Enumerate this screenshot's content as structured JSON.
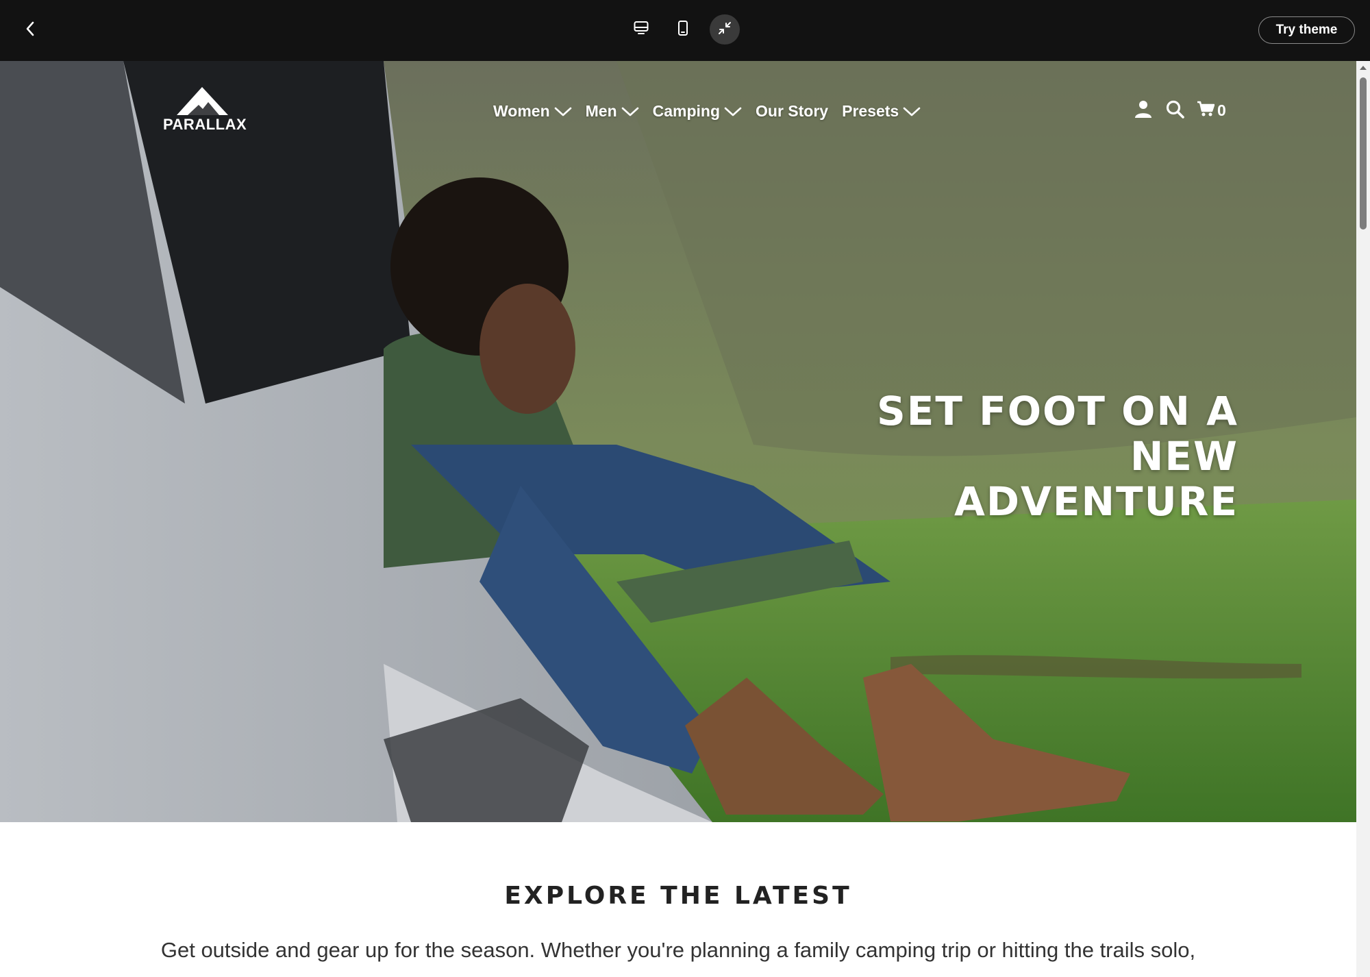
{
  "toolbar": {
    "back_icon": "chevron-left-icon",
    "view_buttons": [
      {
        "icon": "desktop-icon",
        "active": false
      },
      {
        "icon": "mobile-icon",
        "active": false
      },
      {
        "icon": "collapse-icon",
        "active": true
      }
    ],
    "try_theme_label": "Try theme"
  },
  "header": {
    "logo_text": "PARALLAX",
    "nav": [
      {
        "label": "Women",
        "has_dropdown": true
      },
      {
        "label": "Men",
        "has_dropdown": true
      },
      {
        "label": "Camping",
        "has_dropdown": true
      },
      {
        "label": "Our Story",
        "has_dropdown": false
      },
      {
        "label": "Presets",
        "has_dropdown": true
      }
    ],
    "icons": [
      "user-icon",
      "search-icon",
      "cart-icon"
    ],
    "cart_count": "0"
  },
  "hero": {
    "title_line1": "SET FOOT ON A NEW",
    "title_line2": "ADVENTURE"
  },
  "explore": {
    "title": "EXPLORE THE LATEST",
    "text": "Get outside and gear up for the season. Whether you're planning a family camping trip or hitting the trails solo,"
  },
  "colors": {
    "topbar": "#121212",
    "text_dark": "#222222",
    "hero_text": "#ffffff"
  }
}
